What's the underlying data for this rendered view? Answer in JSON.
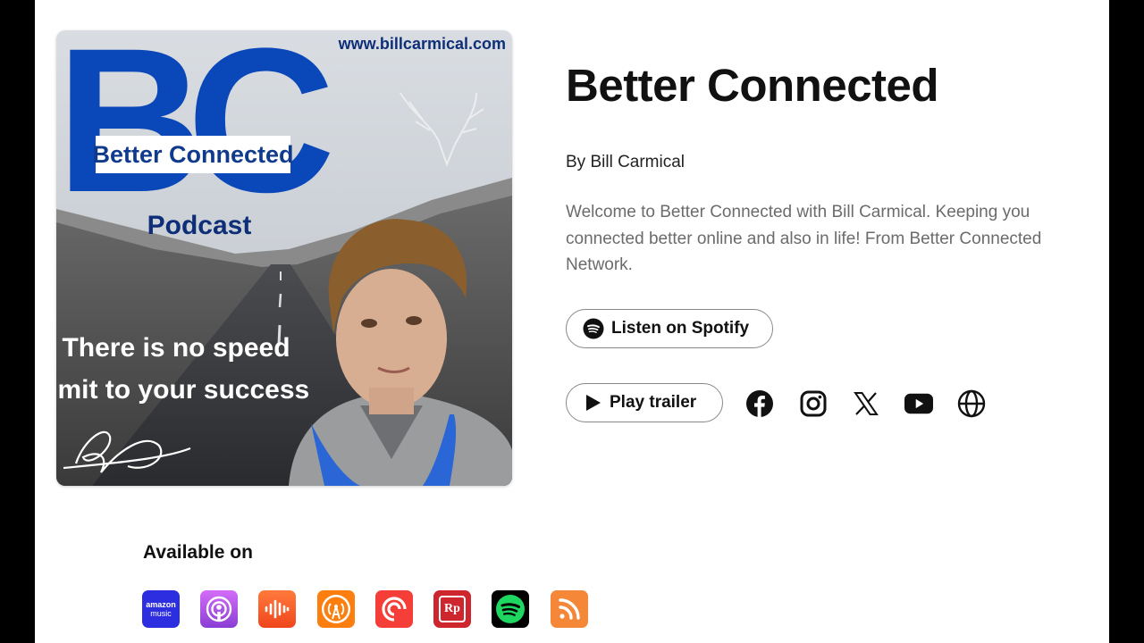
{
  "podcast": {
    "title": "Better Connected",
    "author": "By Bill Carmical",
    "description": "Welcome to Better Connected with Bill Carmical. Keeping you connected better online and also in life! From Better Connected Network."
  },
  "cover": {
    "url_text": "www.billcarmical.com",
    "logo_letters": "BC",
    "logo_banner": "Better Connected",
    "logo_sub": "Podcast",
    "slogan_line1": "There is no speed",
    "slogan_line2": "limit to your success",
    "signature_text": "BC",
    "brand_color": "#0a47b8"
  },
  "buttons": {
    "spotify_label": "Listen on Spotify",
    "trailer_label": "Play trailer"
  },
  "social_icons": [
    "facebook-icon",
    "instagram-icon",
    "x-icon",
    "youtube-icon",
    "website-globe-icon"
  ],
  "available": {
    "heading": "Available on",
    "platforms": [
      {
        "icon": "amazon-music-icon",
        "line1": "amazon",
        "line2": "music",
        "color": "#2d2ee0"
      },
      {
        "icon": "apple-podcasts-icon",
        "color": "#b34fe6"
      },
      {
        "icon": "castbox-icon",
        "color": "#f55b23"
      },
      {
        "icon": "overcast-icon",
        "color": "#fc7e0f"
      },
      {
        "icon": "pocket-casts-icon",
        "color": "#f43e37"
      },
      {
        "icon": "radiopublic-icon",
        "line1": "Rp",
        "color": "#ce262f"
      },
      {
        "icon": "spotify-icon",
        "color": "#000000"
      },
      {
        "icon": "rss-icon",
        "color": "#f58738"
      }
    ]
  }
}
